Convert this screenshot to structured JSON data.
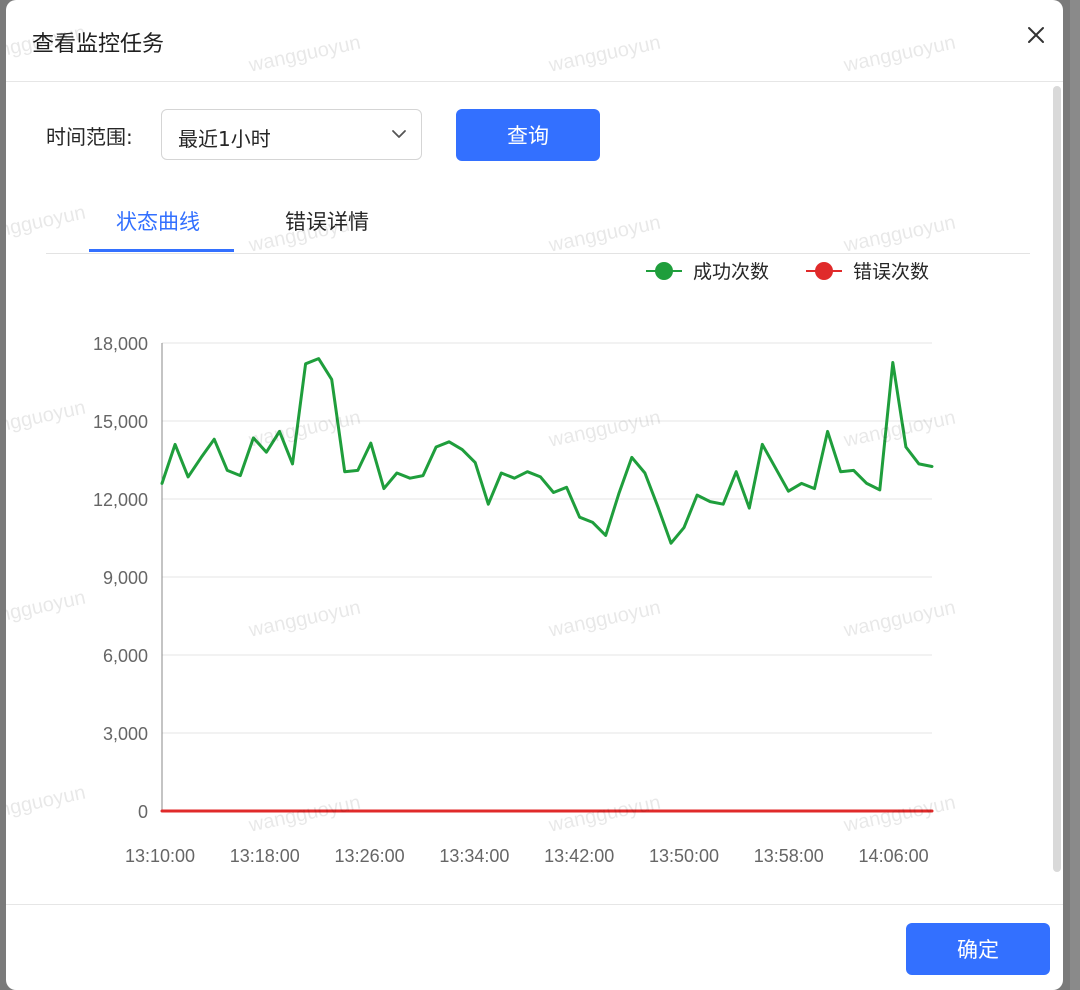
{
  "dialog": {
    "title": "查看监控任务",
    "close_icon": "close-icon"
  },
  "filter": {
    "label": "时间范围:",
    "selected": "最近1小时",
    "query_label": "查询"
  },
  "tabs": [
    {
      "label": "状态曲线",
      "active": true
    },
    {
      "label": "错误详情",
      "active": false
    }
  ],
  "footer": {
    "ok_label": "确定"
  },
  "watermark": "wangguoyun",
  "colors": {
    "accent": "#3370ff",
    "success": "#1f9e3c",
    "error": "#e02a2a"
  },
  "chart_data": {
    "type": "line",
    "legend_placement": "top-right",
    "grid": true,
    "ylim": [
      0,
      18000
    ],
    "y_ticks": [
      "18,000",
      "15,000",
      "12,000",
      "9,000",
      "6,000",
      "3,000",
      "0"
    ],
    "x_ticks": [
      "13:10:00",
      "13:18:00",
      "13:26:00",
      "13:34:00",
      "13:42:00",
      "13:50:00",
      "13:58:00",
      "14:06:00"
    ],
    "x_start": "13:10:00",
    "x_end": "14:09:00",
    "series": [
      {
        "name": "成功次数",
        "color": "#1f9e3c",
        "values": [
          12600,
          14100,
          12850,
          13600,
          14300,
          13100,
          12900,
          14350,
          13800,
          14600,
          13350,
          17200,
          17400,
          16600,
          13050,
          13100,
          14150,
          12400,
          13000,
          12800,
          12900,
          14000,
          14200,
          13900,
          13400,
          11800,
          13000,
          12800,
          13050,
          12850,
          12250,
          12450,
          11300,
          11100,
          10600,
          12200,
          13600,
          13000,
          11700,
          10300,
          10900,
          12150,
          11900,
          11800,
          13050,
          11650,
          14100,
          13200,
          12300,
          12600,
          12400,
          14600,
          13050,
          13100,
          12600,
          12350,
          17250,
          14000,
          13350,
          13250
        ]
      },
      {
        "name": "错误次数",
        "color": "#e02a2a",
        "values": [
          0,
          0,
          0,
          0,
          0,
          0,
          0,
          0,
          0,
          0,
          0,
          0,
          0,
          0,
          0,
          0,
          0,
          0,
          0,
          0,
          0,
          0,
          0,
          0,
          0,
          0,
          0,
          0,
          0,
          0,
          0,
          0,
          0,
          0,
          0,
          0,
          0,
          0,
          0,
          0,
          0,
          0,
          0,
          0,
          0,
          0,
          0,
          0,
          0,
          0,
          0,
          0,
          0,
          0,
          0,
          0,
          0,
          0,
          0,
          0
        ]
      }
    ]
  }
}
